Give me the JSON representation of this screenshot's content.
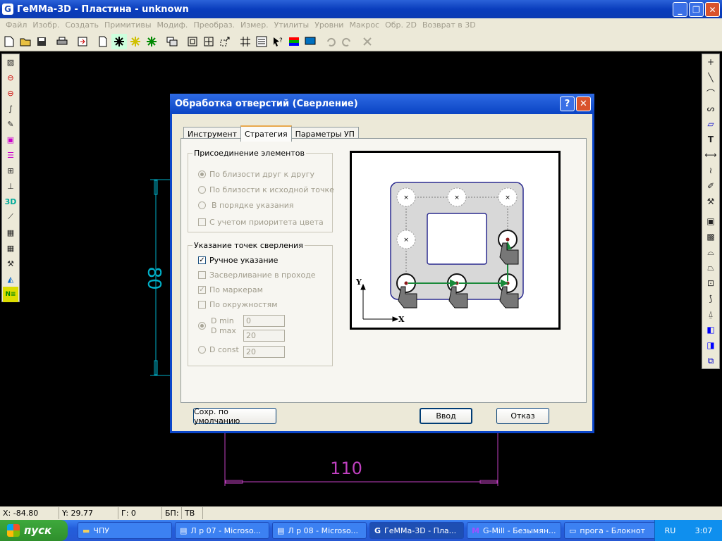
{
  "app": {
    "title": "ГеММа-3D - Пластина - unknown",
    "icon_letter": "G",
    "window_buttons": [
      "_",
      "❐",
      "✕"
    ]
  },
  "menu": [
    "Файл",
    "Изобр.",
    "Создать",
    "Примитивы",
    "Модиф.",
    "Преобраз.",
    "Измер.",
    "Утилиты",
    "Уровни",
    "Макрос",
    "Обр. 2D",
    "Возврат в 3D"
  ],
  "canvas": {
    "dim_vertical": "80",
    "dim_horizontal": "110",
    "colors": {
      "vertical_dim": "#00b0c8",
      "horizontal_dim": "#c040c0"
    }
  },
  "dialog": {
    "title": "Обработка отверстий (Сверление)",
    "help_label": "?",
    "close_label": "✕",
    "tabs": [
      {
        "label": "Инструмент",
        "active": false
      },
      {
        "label": "Стратегия",
        "active": true
      },
      {
        "label": "Параметры УП",
        "active": false
      }
    ],
    "group1": {
      "legend": "Присоединение элементов",
      "options": [
        {
          "label": "По близости друг к другу",
          "type": "radio",
          "checked": true
        },
        {
          "label": "По близости к исходной точке",
          "type": "radio",
          "checked": false
        },
        {
          "label": "В порядке указания",
          "type": "radio",
          "checked": false
        },
        {
          "label": "С учетом приоритета цвета",
          "type": "check",
          "checked": false
        }
      ]
    },
    "group2": {
      "legend": "Указание точек сверления",
      "options": [
        {
          "label": "Ручное указание",
          "type": "check",
          "checked": true,
          "enabled": true
        },
        {
          "label": "Засверливание в проходе",
          "type": "check",
          "checked": false
        },
        {
          "label": "По маркерам",
          "type": "check",
          "checked": true
        },
        {
          "label": "По окружностям",
          "type": "check",
          "checked": false
        }
      ],
      "dmin_label": "D min",
      "dmax_label": "D max",
      "dconst_label": "D const",
      "dmin_value": "0",
      "dmax_value": "20",
      "dconst_value": "20"
    },
    "preview": {
      "axis_x": "X",
      "axis_y": "Y"
    },
    "buttons": {
      "save_default": "Сохр. по умолчанию",
      "ok": "Ввод",
      "cancel": "Отказ"
    }
  },
  "status": {
    "x_label": "X:",
    "x_value": "-84.80",
    "y_label": "Y:",
    "y_value": "29.77",
    "g_label": "Г:",
    "g_value": "0",
    "bp_label": "БП:",
    "bp_value": "ТВ"
  },
  "taskbar": {
    "start": "пуск",
    "tasks": [
      {
        "label": "ЧПУ",
        "icon": "folder-icon"
      },
      {
        "label": "Л р 07 - Microso...",
        "icon": "word-icon"
      },
      {
        "label": "Л р 08 - Microso...",
        "icon": "word-icon"
      },
      {
        "label": "ГеММа-3D - Пла...",
        "icon": "gemma-icon",
        "active": true
      },
      {
        "label": "G-Mill - Безымян...",
        "icon": "gmill-icon"
      },
      {
        "label": "прога - Блокнот",
        "icon": "notepad-icon"
      }
    ],
    "lang": "RU",
    "clock": "3:07"
  }
}
